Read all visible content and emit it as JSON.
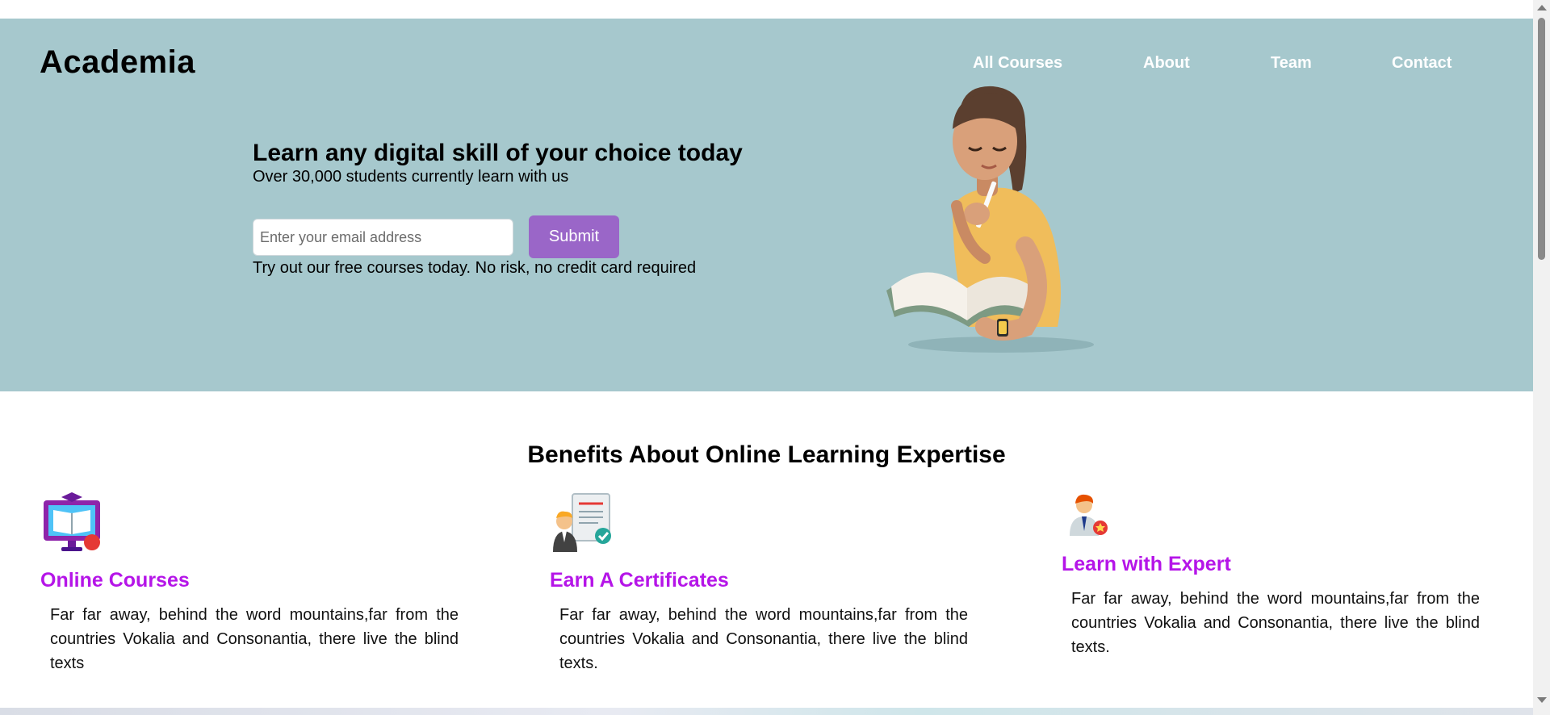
{
  "brand": {
    "name": "Academia"
  },
  "nav": {
    "items": [
      "All Courses",
      "About",
      "Team",
      "Contact"
    ]
  },
  "hero": {
    "headline": "Learn any digital skill of your choice today",
    "subline": "Over 30,000 students currently learn with us",
    "email_placeholder": "Enter your email address",
    "submit_label": "Submit",
    "note": "Try out our free courses today. No risk, no credit card required",
    "illustration": "student-reading-book-illustration"
  },
  "benefits": {
    "title": "Benefits About Online Learning Expertise",
    "cards": [
      {
        "icon": "online-course-computer-icon",
        "title": "Online Courses",
        "text": "Far far away, behind the word mountains,far from the countries Vokalia and Consonantia, there live the blind texts"
      },
      {
        "icon": "certificate-icon",
        "title": "Earn A Certificates",
        "text": "Far far away, behind the word mountains,far from the countries Vokalia and Consonantia, there live the blind texts."
      },
      {
        "icon": "expert-icon",
        "title": "Learn with Expert",
        "text": "Far far away, behind the word mountains,far from the countries Vokalia and Consonantia, there live the blind texts."
      }
    ]
  },
  "colors": {
    "hero_bg": "#a6c8cd",
    "accent_purple": "#b515e8",
    "button": "#9a66c8"
  }
}
